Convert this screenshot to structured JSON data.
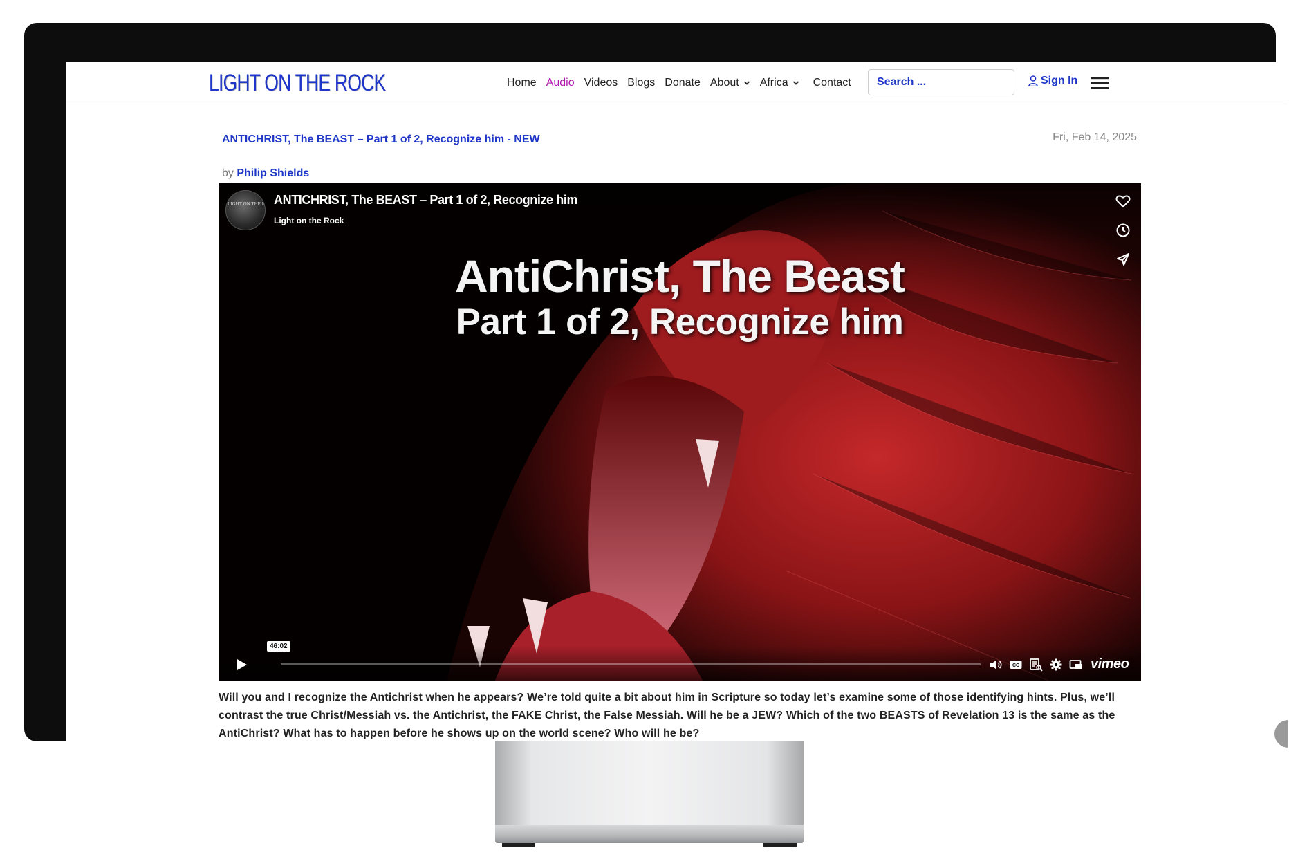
{
  "site": {
    "logo_text": "LIGHT ON THE ROCK"
  },
  "nav": {
    "items": [
      {
        "label": "Home",
        "active": false,
        "has_dropdown": false
      },
      {
        "label": "Audio",
        "active": true,
        "has_dropdown": false
      },
      {
        "label": "Videos",
        "active": false,
        "has_dropdown": false
      },
      {
        "label": "Blogs",
        "active": false,
        "has_dropdown": false
      },
      {
        "label": "Donate",
        "active": false,
        "has_dropdown": false
      },
      {
        "label": "About",
        "active": false,
        "has_dropdown": true
      },
      {
        "label": "Africa",
        "active": false,
        "has_dropdown": true
      },
      {
        "label": "Contact",
        "active": false,
        "has_dropdown": false
      }
    ],
    "search_placeholder": "Search ...",
    "signin_label": "Sign In"
  },
  "article": {
    "title": "ANTICHRIST, The BEAST – Part 1 of 2, Recognize him - NEW",
    "date": "Fri, Feb 14, 2025",
    "by_prefix": "by",
    "author": "Philip Shields",
    "description": "Will you and I recognize the Antichrist when he appears? We’re told quite a bit about him in Scripture so today let’s examine some of those identifying hints. Plus, we’ll contrast the true Christ/Messiah vs. the Antichrist, the FAKE Christ, the False Messiah. Will he be a JEW? Which of the two BEASTS of Revelation 13 is the same as the AntiChrist? What has to happen before he shows up on the world scene? Who will he be?"
  },
  "video": {
    "title": "ANTICHRIST, The BEAST – Part 1 of 2, Recognize him",
    "channel": "Light on the Rock",
    "avatar_text": "LIGHT ON THE ROCK",
    "overlay_title": "AntiChrist, The Beast",
    "overlay_subtitle": "Part 1 of 2, Recognize him",
    "duration": "46:02",
    "progress_fraction": 0,
    "player_brand": "vimeo",
    "side_icons": [
      "heart-icon",
      "clock-icon",
      "share-icon"
    ],
    "control_icons": [
      "volume-icon",
      "captions-icon",
      "transcript-icon",
      "settings-icon",
      "pip-icon"
    ]
  },
  "colors": {
    "brand_blue": "#1f37c9",
    "active_nav": "#b015b0",
    "date_gray": "#8a8a8a",
    "lion_red": "#b01c1c"
  }
}
